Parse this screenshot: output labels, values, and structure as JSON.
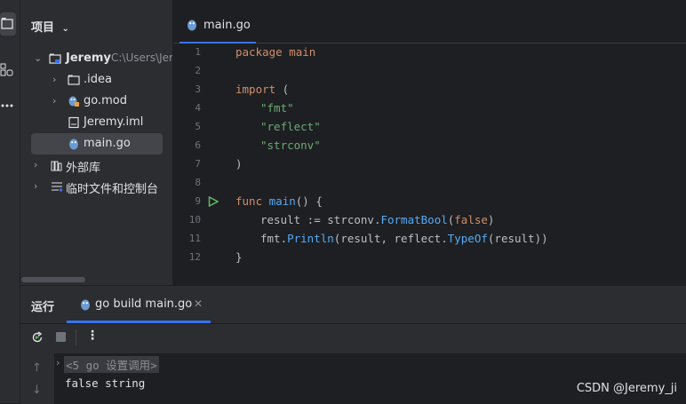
{
  "project_panel": {
    "header": "项目",
    "tree": [
      {
        "label": "Jeremy",
        "path": "C:\\Users\\Jer"
      },
      {
        "label": ".idea"
      },
      {
        "label": "go.mod"
      },
      {
        "label": "Jeremy.iml"
      },
      {
        "label": "main.go"
      },
      {
        "label": "外部库"
      },
      {
        "label": "临时文件和控制台"
      }
    ]
  },
  "editor": {
    "tab": "main.go",
    "lines": [
      {
        "n": "1"
      },
      {
        "n": "2"
      },
      {
        "n": "3"
      },
      {
        "n": "4"
      },
      {
        "n": "5"
      },
      {
        "n": "6"
      },
      {
        "n": "7"
      },
      {
        "n": "8"
      },
      {
        "n": "9"
      },
      {
        "n": "10"
      },
      {
        "n": "11"
      },
      {
        "n": "12"
      }
    ],
    "code": {
      "l1_kw": "package",
      "l1_rest": " main",
      "l3_kw": "import",
      "l3_rest": " (",
      "l4": "\"fmt\"",
      "l5": "\"reflect\"",
      "l6": "\"strconv\"",
      "l7": ")",
      "l9_kw": "func",
      "l9_fn": "main",
      "l9_rest": "() {",
      "l10_a": "result := ",
      "l10_pkg": "strconv.",
      "l10_call": "FormatBool",
      "l10_b": "(",
      "l10_bool": "false",
      "l10_c": ")",
      "l11_a": "fmt.",
      "l11_call": "Println",
      "l11_b": "(result, reflect.",
      "l11_call2": "TypeOf",
      "l11_c": "(result))",
      "l12": "}"
    }
  },
  "run_panel": {
    "title": "运行",
    "tab": "go build main.go",
    "console": {
      "line1": "<5 go 设置调用>",
      "line2": "false string"
    }
  },
  "watermark": "CSDN @Jeremy_ji",
  "colors": {
    "accent": "#3574f0",
    "keyword": "#cf8e6d",
    "string": "#6aab73",
    "function": "#56a8f5",
    "run": "#5fb865"
  }
}
